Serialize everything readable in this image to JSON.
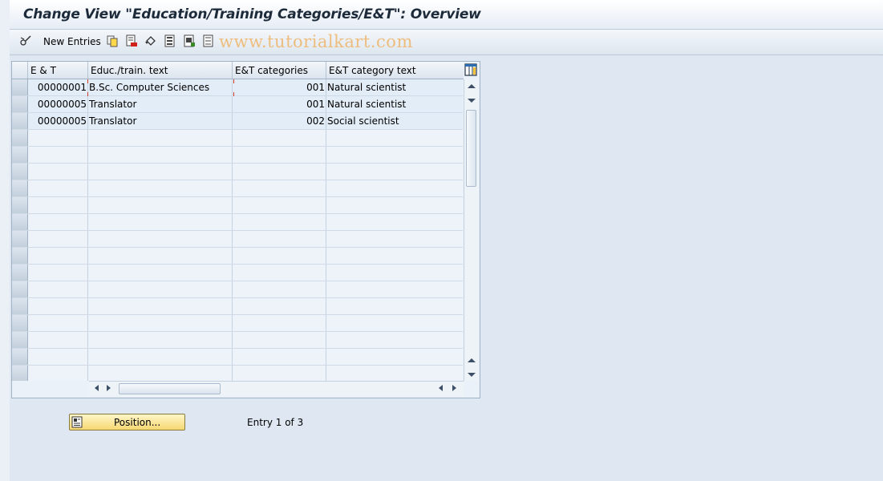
{
  "title": "Change View \"Education/Training Categories/E&T\": Overview",
  "toolbar": {
    "new_entries_label": "New Entries",
    "icons": [
      "edit-glasses-icon",
      "copy-icon",
      "delete-icon",
      "undo-icon",
      "select-all-icon",
      "select-block-icon",
      "deselect-all-icon"
    ]
  },
  "watermark": "www.tutorialkart.com",
  "table": {
    "columns": [
      "E & T",
      "Educ./train. text",
      "E&T categories",
      "E&T category text"
    ],
    "rows": [
      {
        "et": "00000001",
        "text": "B.Sc. Computer Sciences",
        "category": "001",
        "category_text": "Natural scientist"
      },
      {
        "et": "00000005",
        "text": "Translator",
        "category": "001",
        "category_text": "Natural scientist"
      },
      {
        "et": "00000005",
        "text": "Translator",
        "category": "002",
        "category_text": "Social scientist"
      }
    ]
  },
  "footer": {
    "position_button_label": "Position...",
    "entry_info": "Entry 1 of 3"
  },
  "colors": {
    "button_yellow": "#f6d873",
    "watermark": "#efb56a",
    "background": "#dfe8f2"
  }
}
